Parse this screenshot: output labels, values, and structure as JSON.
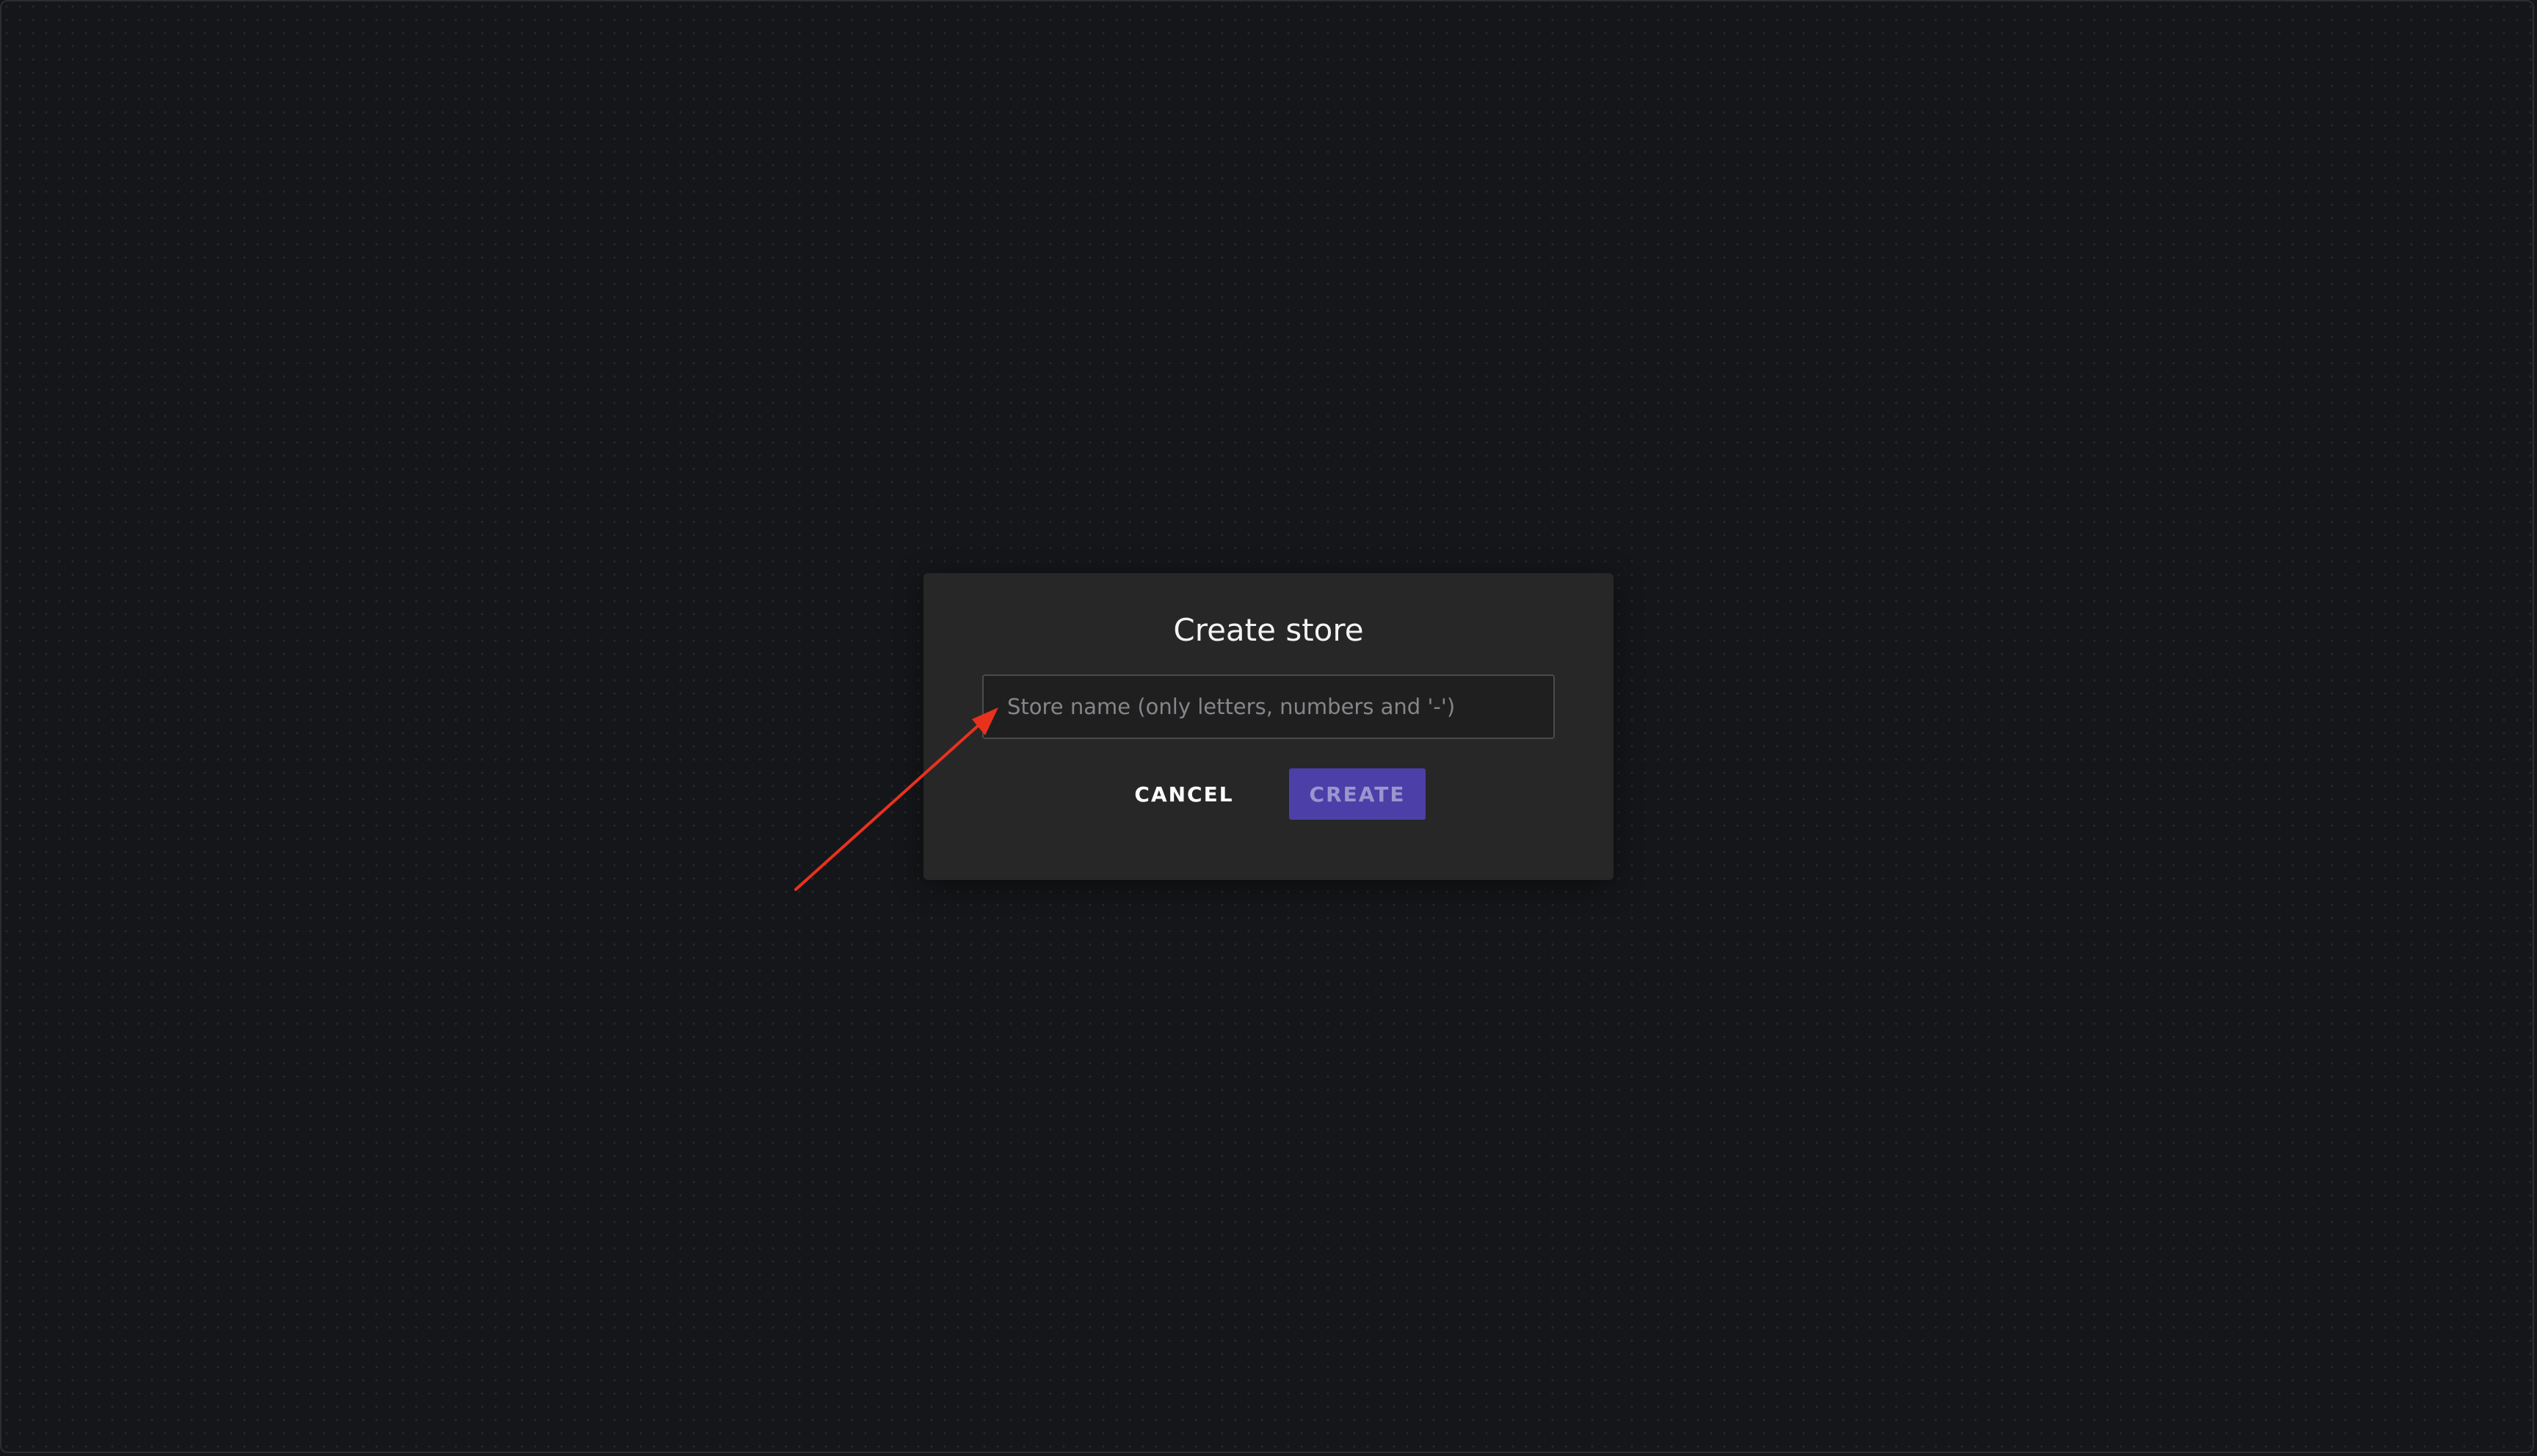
{
  "dialog": {
    "title": "Create store",
    "store_name_input": {
      "value": "",
      "placeholder": "Store name (only letters, numbers and '-')"
    },
    "cancel_label": "CANCEL",
    "create_label": "CREATE"
  },
  "colors": {
    "background": "#151619",
    "dialog_background": "#272728",
    "primary_button": "#4c3fa8",
    "annotation_arrow": "#e8321e"
  }
}
